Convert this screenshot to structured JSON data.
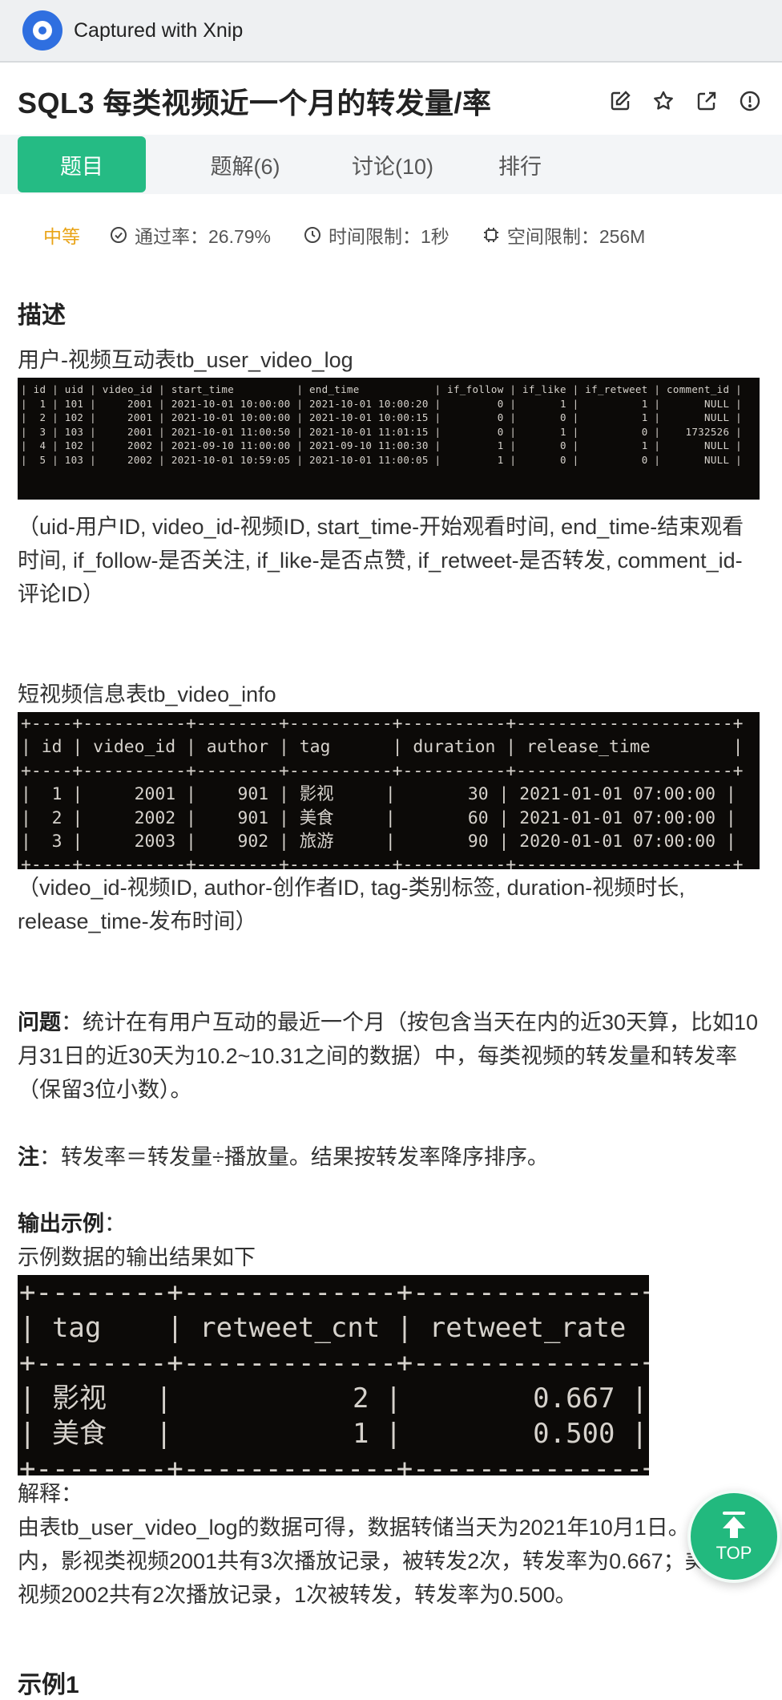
{
  "capture": {
    "title": "Captured with Xnip"
  },
  "problem": {
    "title": "SQL3  每类视频近一个月的转发量/率",
    "tabs": [
      "题目",
      "题解(6)",
      "讨论(10)",
      "排行"
    ],
    "difficulty": "中等",
    "pass_rate": "通过率：26.79%",
    "time_limit": "时间限制：1秒",
    "space_limit": "空间限制：256M"
  },
  "description": {
    "heading": "描述",
    "table1_caption": "用户-视频互动表tb_user_video_log",
    "table1_text": "| id | uid | video_id | start_time          | end_time            | if_follow | if_like | if_retweet | comment_id |\n|  1 | 101 |     2001 | 2021-10-01 10:00:00 | 2021-10-01 10:00:20 |         0 |       1 |          1 |       NULL |\n|  2 | 102 |     2001 | 2021-10-01 10:00:00 | 2021-10-01 10:00:15 |         0 |       0 |          1 |       NULL |\n|  3 | 103 |     2001 | 2021-10-01 11:00:50 | 2021-10-01 11:01:15 |         0 |       1 |          0 |    1732526 |\n|  4 | 102 |     2002 | 2021-09-10 11:00:00 | 2021-09-10 11:00:30 |         1 |       0 |          1 |       NULL |\n|  5 | 103 |     2002 | 2021-10-01 10:59:05 | 2021-10-01 11:00:05 |         1 |       0 |          0 |       NULL |",
    "table1_note": "（uid-用户ID, video_id-视频ID, start_time-开始观看时间, end_time-结束观看时间, if_follow-是否关注, if_like-是否点赞, if_retweet-是否转发, comment_id-评论ID）",
    "table2_caption": "短视频信息表tb_video_info",
    "table2_text": "+----+----------+--------+----------+----------+---------------------+\n| id | video_id | author | tag      | duration | release_time        |\n+----+----------+--------+----------+----------+---------------------+\n|  1 |     2001 |    901 | 影视     |       30 | 2021-01-01 07:00:00 |\n|  2 |     2002 |    901 | 美食     |       60 | 2021-01-01 07:00:00 |\n|  3 |     2003 |    902 | 旅游     |       90 | 2020-01-01 07:00:00 |\n+----+----------+--------+----------+----------+---------------------+",
    "table2_note": "（video_id-视频ID, author-创作者ID, tag-类别标签, duration-视频时长, release_time-发布时间）",
    "question_label": "问题",
    "question_text": "：统计在有用户互动的最近一个月（按包含当天在内的近30天算，比如10月31日的近30天为10.2~10.31之间的数据）中，每类视频的转发量和转发率（保留3位小数）。",
    "note_label": "注",
    "note_text": "：转发率＝转发量÷播放量。结果按转发率降序排序。",
    "output_label": "输出示例",
    "output_colon": "：",
    "output_desc": "示例数据的输出结果如下",
    "table3_text": "+--------+-------------+--------------+\n| tag    | retweet_cnt | retweet_rate |\n+--------+-------------+--------------+\n| 影视   |           2 |        0.667 |\n| 美食   |           1 |        0.500 |\n+--------+-------------+--------------+",
    "explain_label": "解释：",
    "explain_text": "由表tb_user_video_log的数据可得，数据转储当天为2021年10月1日。近30天内，影视类视频2001共有3次播放记录，被转发2次，转发率为0.667；美食类视频2002共有2次播放记录，1次被转发，转发率为0.500。",
    "example_heading": "示例1"
  },
  "top_button": {
    "label": "TOP"
  }
}
